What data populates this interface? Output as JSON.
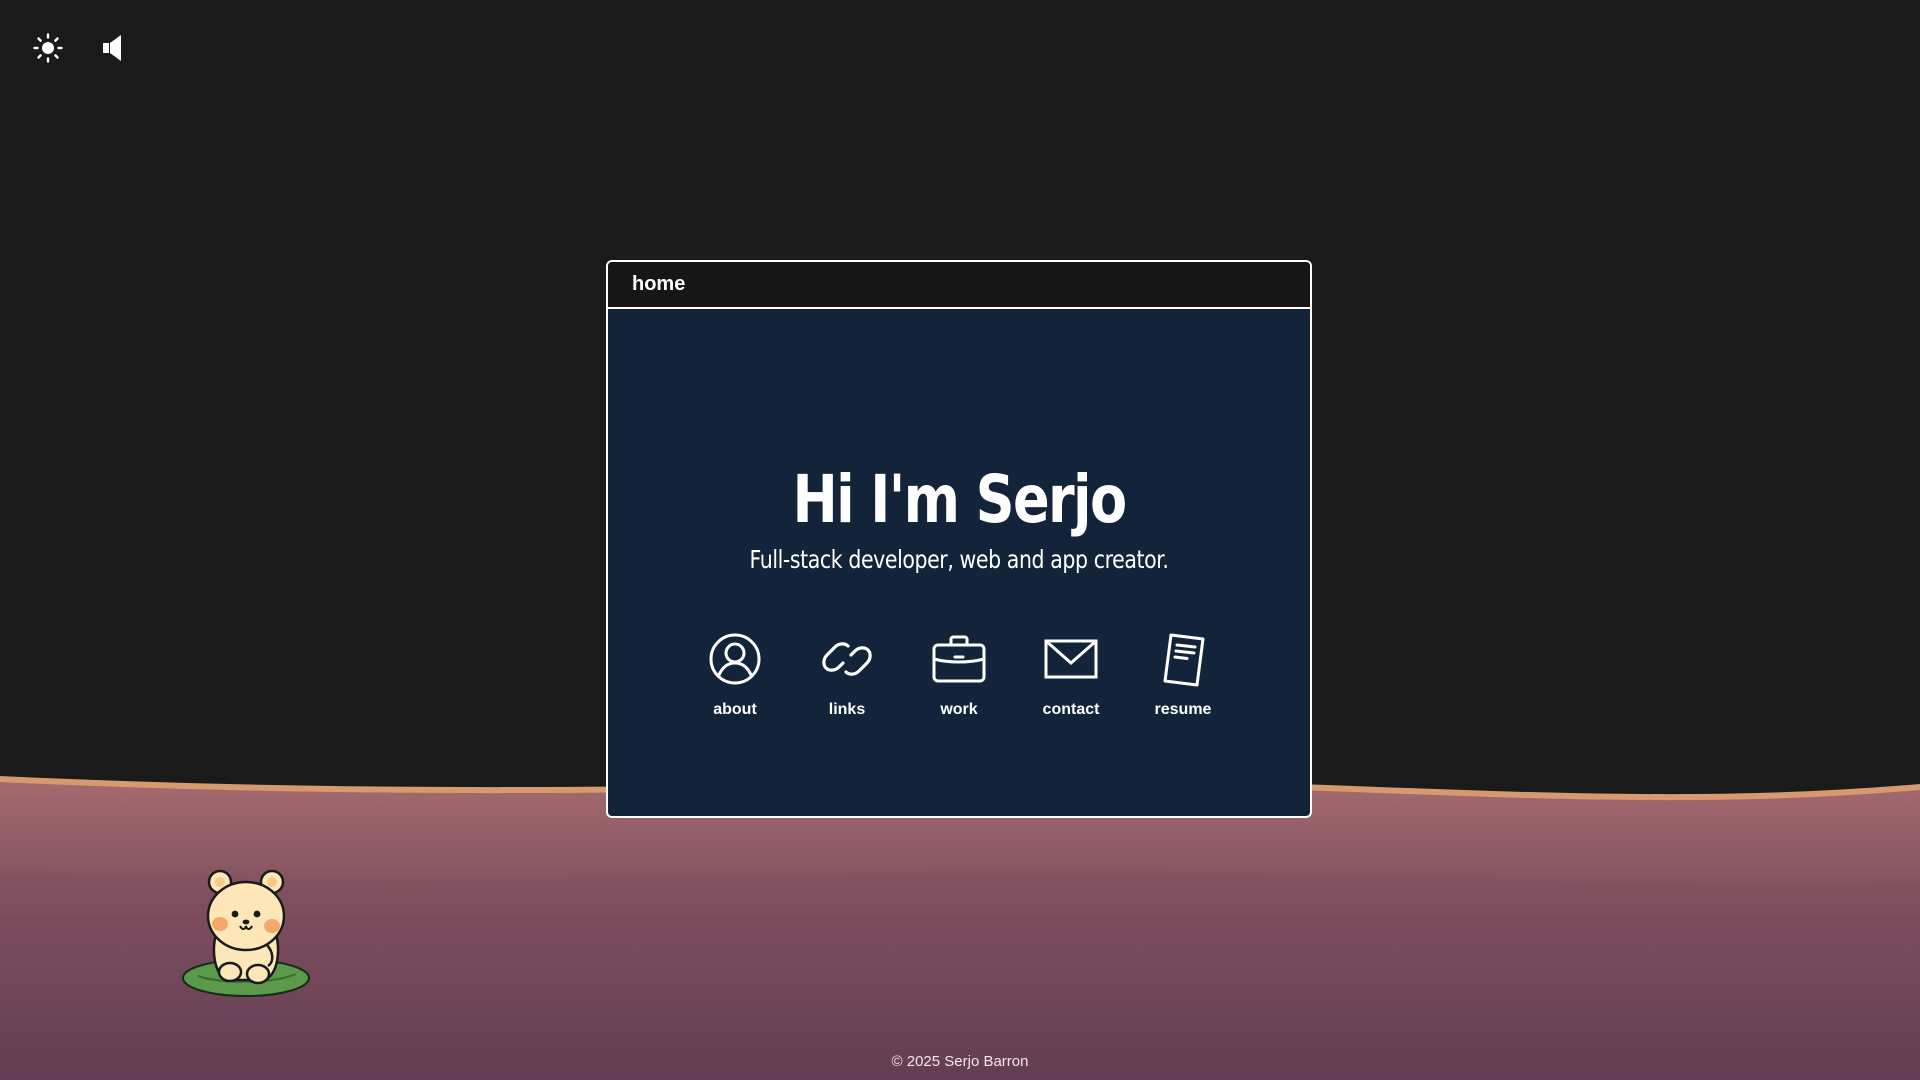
{
  "controls": {
    "theme_icon": "sun-icon",
    "sound_icon": "speaker-icon"
  },
  "window": {
    "title": "home"
  },
  "hero": {
    "headline": "Hi I'm Serjo",
    "subheadline": "Full-stack developer, web and app creator."
  },
  "nav": {
    "items": [
      {
        "label": "about",
        "icon": "user-icon"
      },
      {
        "label": "links",
        "icon": "link-icon"
      },
      {
        "label": "work",
        "icon": "briefcase-icon"
      },
      {
        "label": "contact",
        "icon": "mail-icon"
      },
      {
        "label": "resume",
        "icon": "document-icon"
      }
    ]
  },
  "mascot": {
    "icon": "bear-mascot"
  },
  "footer": {
    "text": "© 2025 Serjo Barron"
  },
  "colors": {
    "background": "#1a1a1a",
    "window_body": "#13233a",
    "window_titlebar": "#161616",
    "terrain_top": "#a46a6e",
    "terrain_bottom": "#55344d",
    "horizon_edge": "#d69a6e",
    "text": "#ffffff"
  }
}
